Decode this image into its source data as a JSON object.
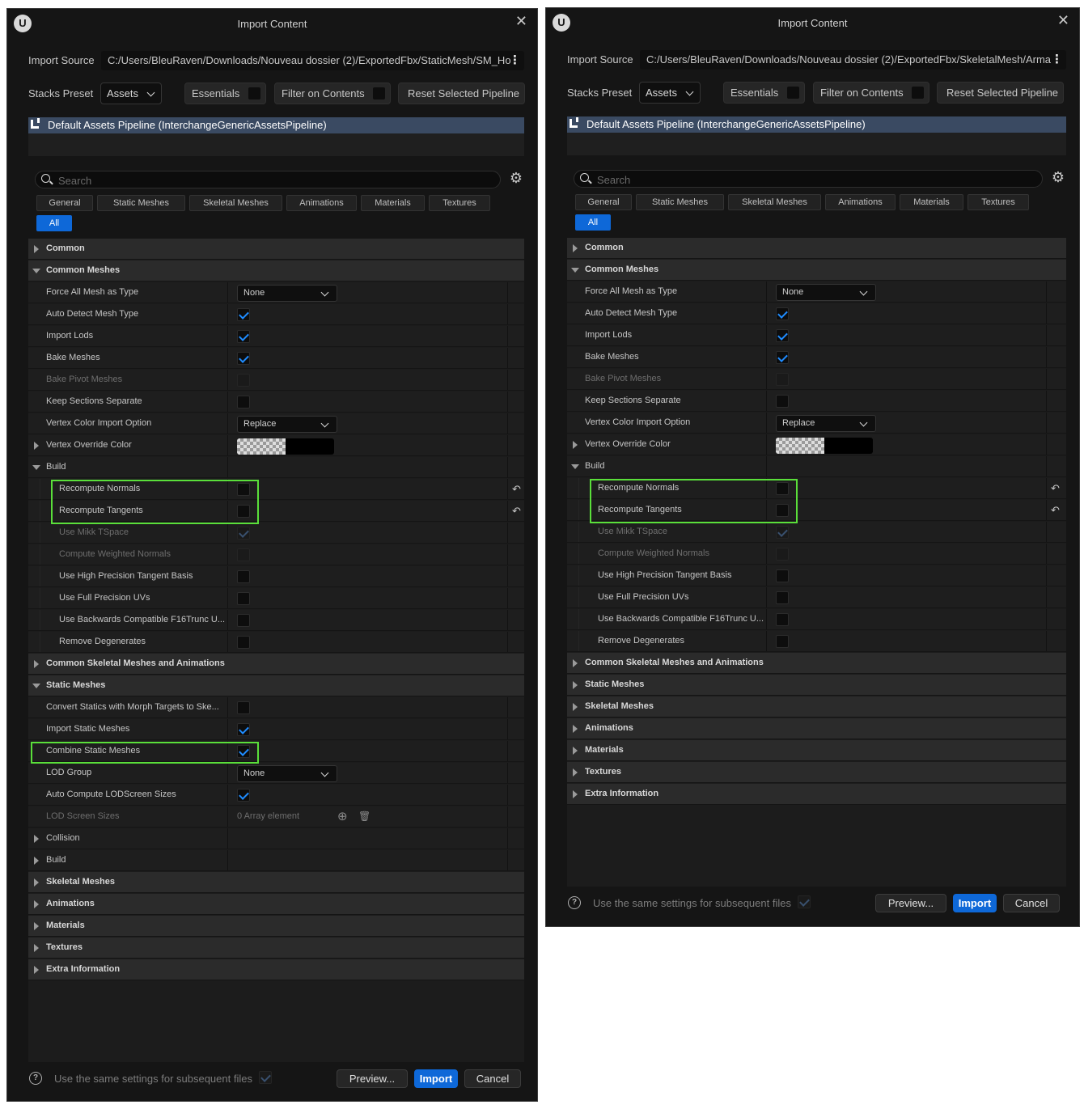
{
  "common": {
    "window_title": "Import Content",
    "close_glyph": "✕",
    "logo_glyph": "U",
    "import_source_label": "Import Source",
    "stacks_preset_label": "Stacks Preset",
    "stacks_preset_value": "Assets",
    "essentials_label": "Essentials",
    "filter_on_contents_label": "Filter on Contents",
    "reset_pipeline_label": "Reset Selected Pipeline",
    "pipeline_name": "Default Assets Pipeline (InterchangeGenericAssetsPipeline)",
    "search_placeholder": "Search",
    "tabs": [
      "General",
      "Static Meshes",
      "Skeletal Meshes",
      "Animations",
      "Materials",
      "Textures",
      "All"
    ],
    "footer_text": "Use the same settings for subsequent files",
    "preview_label": "Preview...",
    "import_label": "Import",
    "cancel_label": "Cancel",
    "help_glyph": "?",
    "gear_glyph": "⚙",
    "reset_glyph": "↶",
    "kebab_glyph": "⋮",
    "add_glyph": "⊕",
    "delete_glyph": "🗑"
  },
  "colors": {
    "accent_blue": "#0e68d8",
    "highlight_green": "#5adf3a",
    "pipeline_bar": "#3a4a62"
  },
  "left": {
    "import_source": "C:/Users/BleuRaven/Downloads/Nouveau dossier (2)/ExportedFbx/StaticMesh/SM_Ho",
    "rows": [
      {
        "type": "cat",
        "label": "Common",
        "expanded": false
      },
      {
        "type": "cat",
        "label": "Common Meshes",
        "expanded": true
      },
      {
        "type": "prop",
        "label": "Force All Mesh as Type",
        "widget": "combo",
        "value": "None"
      },
      {
        "type": "prop",
        "label": "Auto Detect Mesh Type",
        "widget": "check",
        "checked": true
      },
      {
        "type": "prop",
        "label": "Import Lods",
        "widget": "check",
        "checked": true
      },
      {
        "type": "prop",
        "label": "Bake Meshes",
        "widget": "check",
        "checked": true
      },
      {
        "type": "prop",
        "label": "Bake Pivot Meshes",
        "widget": "check",
        "checked": false,
        "disabled": true
      },
      {
        "type": "prop",
        "label": "Keep Sections Separate",
        "widget": "check",
        "checked": false
      },
      {
        "type": "prop",
        "label": "Vertex Color Import Option",
        "widget": "combo",
        "value": "Replace"
      },
      {
        "type": "prop",
        "label": "Vertex Override Color",
        "widget": "color",
        "expandable": true
      },
      {
        "type": "sub",
        "label": "Build",
        "expanded": true
      },
      {
        "type": "prop",
        "label": "Recompute Normals",
        "widget": "check",
        "checked": false,
        "indent": 1,
        "reset": true
      },
      {
        "type": "prop",
        "label": "Recompute Tangents",
        "widget": "check",
        "checked": false,
        "indent": 1,
        "reset": true
      },
      {
        "type": "prop",
        "label": "Use Mikk TSpace",
        "widget": "check",
        "checked": true,
        "disabled": true,
        "indent": 1
      },
      {
        "type": "prop",
        "label": "Compute Weighted Normals",
        "widget": "check",
        "checked": false,
        "disabled": true,
        "indent": 1
      },
      {
        "type": "prop",
        "label": "Use High Precision Tangent Basis",
        "widget": "check",
        "checked": false,
        "indent": 1
      },
      {
        "type": "prop",
        "label": "Use Full Precision UVs",
        "widget": "check",
        "checked": false,
        "indent": 1
      },
      {
        "type": "prop",
        "label": "Use Backwards Compatible F16Trunc U...",
        "widget": "check",
        "checked": false,
        "indent": 1
      },
      {
        "type": "prop",
        "label": "Remove Degenerates",
        "widget": "check",
        "checked": false,
        "indent": 1
      },
      {
        "type": "cat",
        "label": "Common Skeletal Meshes and Animations",
        "expanded": false
      },
      {
        "type": "cat",
        "label": "Static Meshes",
        "expanded": true
      },
      {
        "type": "prop",
        "label": "Convert Statics with Morph Targets to Ske...",
        "widget": "check",
        "checked": false
      },
      {
        "type": "prop",
        "label": "Import Static Meshes",
        "widget": "check",
        "checked": true
      },
      {
        "type": "prop",
        "label": "Combine Static Meshes",
        "widget": "check",
        "checked": true
      },
      {
        "type": "prop",
        "label": "LOD Group",
        "widget": "combo",
        "value": "None"
      },
      {
        "type": "prop",
        "label": "Auto Compute LODScreen Sizes",
        "widget": "check",
        "checked": true
      },
      {
        "type": "prop",
        "label": "LOD Screen Sizes",
        "widget": "array",
        "value": "0 Array element",
        "disabled": true
      },
      {
        "type": "sub",
        "label": "Collision",
        "expanded": false
      },
      {
        "type": "sub",
        "label": "Build",
        "expanded": false
      },
      {
        "type": "cat",
        "label": "Skeletal Meshes",
        "expanded": false
      },
      {
        "type": "cat",
        "label": "Animations",
        "expanded": false
      },
      {
        "type": "cat",
        "label": "Materials",
        "expanded": false
      },
      {
        "type": "cat",
        "label": "Textures",
        "expanded": false
      },
      {
        "type": "cat",
        "label": "Extra Information",
        "expanded": false
      }
    ]
  },
  "right": {
    "import_source": "C:/Users/BleuRaven/Downloads/Nouveau dossier (2)/ExportedFbx/SkeletalMesh/Arma",
    "rows": [
      {
        "type": "cat",
        "label": "Common",
        "expanded": false
      },
      {
        "type": "cat",
        "label": "Common Meshes",
        "expanded": true
      },
      {
        "type": "prop",
        "label": "Force All Mesh as Type",
        "widget": "combo",
        "value": "None"
      },
      {
        "type": "prop",
        "label": "Auto Detect Mesh Type",
        "widget": "check",
        "checked": true
      },
      {
        "type": "prop",
        "label": "Import Lods",
        "widget": "check",
        "checked": true
      },
      {
        "type": "prop",
        "label": "Bake Meshes",
        "widget": "check",
        "checked": true
      },
      {
        "type": "prop",
        "label": "Bake Pivot Meshes",
        "widget": "check",
        "checked": false,
        "disabled": true
      },
      {
        "type": "prop",
        "label": "Keep Sections Separate",
        "widget": "check",
        "checked": false
      },
      {
        "type": "prop",
        "label": "Vertex Color Import Option",
        "widget": "combo",
        "value": "Replace"
      },
      {
        "type": "prop",
        "label": "Vertex Override Color",
        "widget": "color",
        "expandable": true
      },
      {
        "type": "sub",
        "label": "Build",
        "expanded": true
      },
      {
        "type": "prop",
        "label": "Recompute Normals",
        "widget": "check",
        "checked": false,
        "indent": 1,
        "reset": true
      },
      {
        "type": "prop",
        "label": "Recompute Tangents",
        "widget": "check",
        "checked": false,
        "indent": 1,
        "reset": true
      },
      {
        "type": "prop",
        "label": "Use Mikk TSpace",
        "widget": "check",
        "checked": true,
        "disabled": true,
        "indent": 1
      },
      {
        "type": "prop",
        "label": "Compute Weighted Normals",
        "widget": "check",
        "checked": false,
        "disabled": true,
        "indent": 1
      },
      {
        "type": "prop",
        "label": "Use High Precision Tangent Basis",
        "widget": "check",
        "checked": false,
        "indent": 1
      },
      {
        "type": "prop",
        "label": "Use Full Precision UVs",
        "widget": "check",
        "checked": false,
        "indent": 1
      },
      {
        "type": "prop",
        "label": "Use Backwards Compatible F16Trunc U...",
        "widget": "check",
        "checked": false,
        "indent": 1
      },
      {
        "type": "prop",
        "label": "Remove Degenerates",
        "widget": "check",
        "checked": false,
        "indent": 1
      },
      {
        "type": "cat",
        "label": "Common Skeletal Meshes and Animations",
        "expanded": false
      },
      {
        "type": "cat",
        "label": "Static Meshes",
        "expanded": false
      },
      {
        "type": "cat",
        "label": "Skeletal Meshes",
        "expanded": false
      },
      {
        "type": "cat",
        "label": "Animations",
        "expanded": false
      },
      {
        "type": "cat",
        "label": "Materials",
        "expanded": false
      },
      {
        "type": "cat",
        "label": "Textures",
        "expanded": false
      },
      {
        "type": "cat",
        "label": "Extra Information",
        "expanded": false
      }
    ]
  }
}
